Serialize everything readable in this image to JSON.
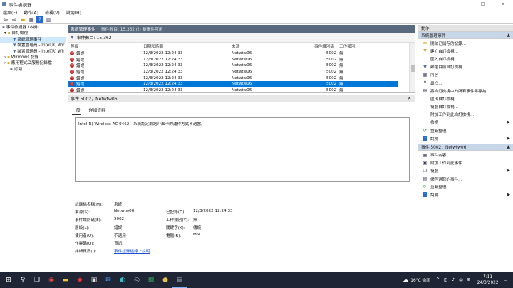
{
  "window": {
    "title": "事件檢視器",
    "min": "─",
    "max": "☐",
    "close": "✕"
  },
  "menu": [
    "檔案(F)",
    "動作(A)",
    "檢視(V)",
    "說明(H)"
  ],
  "tree": {
    "root": "事件檢視器 (本機)",
    "custom_views": "自訂檢視",
    "admin_events": "系統管理事件",
    "device_mgr1": "裝置管理員 - Intel(R) Wir",
    "device_mgr2": "裝置管理員 - Intel(R) Wir",
    "windows_logs": "Windows 記錄",
    "app_logs": "應用程式及服務記錄檔",
    "subscriptions": "訂閱"
  },
  "center": {
    "title": "系統管理事件",
    "subtitle": "事件數目: 15,362 (!) 新事件可用",
    "filter_label": "事件數目: 15,362",
    "columns": {
      "level": "等級",
      "date": "日期和時間",
      "source": "來源",
      "event_id": "事件識別碼",
      "category": "工作類別"
    }
  },
  "events": [
    {
      "level": "錯誤",
      "date": "12/3/2022 12:24:33",
      "source": "Netwtw06",
      "event_id": "5002",
      "category": "無"
    },
    {
      "level": "錯誤",
      "date": "12/3/2022 12:24:33",
      "source": "Netwtw06",
      "event_id": "5002",
      "category": "無"
    },
    {
      "level": "錯誤",
      "date": "12/3/2022 12:24:33",
      "source": "Netwtw06",
      "event_id": "5002",
      "category": "無"
    },
    {
      "level": "錯誤",
      "date": "12/3/2022 12:24:33",
      "source": "Netwtw06",
      "event_id": "5002",
      "category": "無"
    },
    {
      "level": "錯誤",
      "date": "12/3/2022 12:24:33",
      "source": "Netwtw06",
      "event_id": "5002",
      "category": "無"
    },
    {
      "level": "錯誤",
      "date": "12/3/2022 12:24:33",
      "source": "Netwtw06",
      "event_id": "5002",
      "category": "無"
    },
    {
      "level": "錯誤",
      "date": "12/3/2022 12:24:33",
      "source": "Netwtw06",
      "event_id": "5002",
      "category": "無"
    }
  ],
  "detail": {
    "header": "事件 5002，Netwtw06",
    "close": "✕",
    "tab_general": "一般",
    "tab_details": "詳細資料",
    "message": "Intel(R) Wireless-AC 9462：系統認定網路介面卡的運作方式不適當。",
    "log_name_label": "記錄檔名稱(M):",
    "log_name": "系統",
    "source_label": "來源(S):",
    "source": "Netwtw06",
    "logged_label": "已記錄(D):",
    "logged": "12/3/2022 12:24:33",
    "event_id_label": "事件識別碼(E):",
    "event_id": "5002",
    "task_label": "工作類別(Y):",
    "task": "無",
    "level_label": "層級(L):",
    "level": "錯誤",
    "keywords_label": "關鍵字(K):",
    "keywords": "傳統",
    "user_label": "使用者(U):",
    "user": "不適用",
    "computer_label": "電腦(R):",
    "computer": "MSI",
    "opcode_label": "作業碼(O):",
    "opcode": "資訊",
    "more_label": "詳細資訊(I):",
    "more_link": "事件記錄檔線上說明"
  },
  "actions": {
    "header1": "動作",
    "section1": "系統管理事件",
    "items1": [
      "開啟已儲存的記錄...",
      "建立自訂檢視...",
      "匯入自訂檢視...",
      "篩選目前自訂檢視...",
      "內容",
      "尋找...",
      "將自訂檢視中的所有事件另存為...",
      "匯出自訂檢視...",
      "複製自訂檢視...",
      "附加工作到此自訂檢視...",
      "檢視",
      "重新整理",
      "說明"
    ],
    "section2": "事件 5002，Netwtw06",
    "items2": [
      "事件內容",
      "附加工作到此事件...",
      "複製",
      "儲存選取的事件...",
      "重新整理",
      "說明"
    ]
  },
  "taskbar": {
    "weather": "16°C 微雨",
    "lang": "中",
    "time": "7:11",
    "date": "24/3/2022"
  }
}
